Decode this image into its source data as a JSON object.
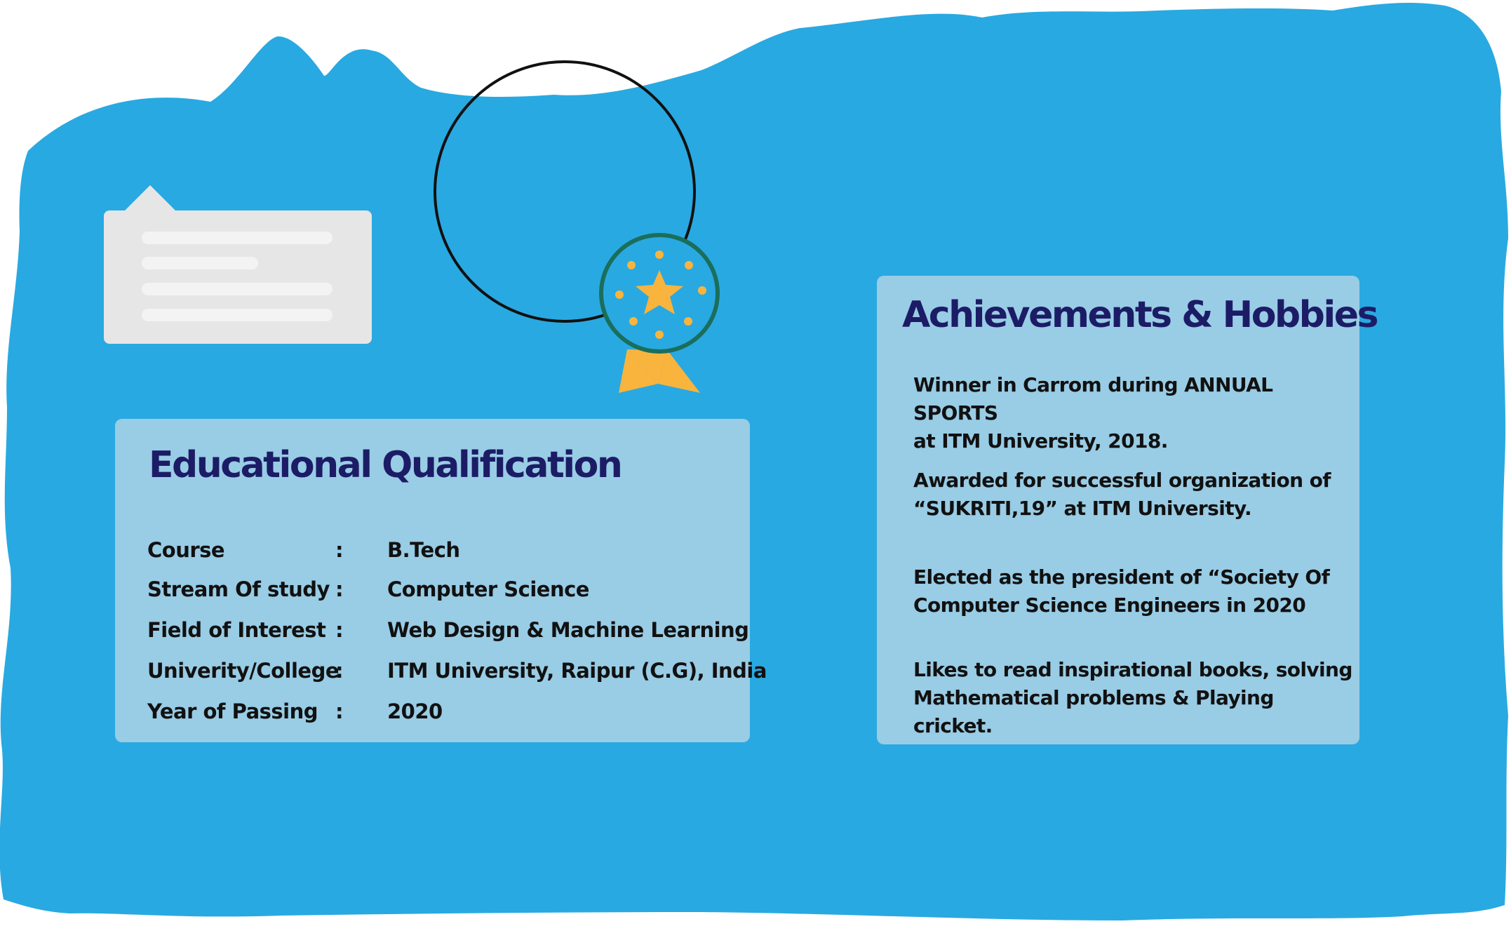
{
  "colors": {
    "background_blob": "#29a9e1",
    "panel": "#99cce5",
    "title_text": "#1c1c66",
    "body_text": "#111111",
    "chat_card": "#e6e6e6",
    "chat_bar": "#f3f3f3",
    "medal_ring": "#1a6e5b",
    "medal_fill": "#29a9e1",
    "medal_ribbon": "#f9b43d",
    "medal_star": "#f9b43d"
  },
  "icons": {
    "chat": "chat-bubble-icon",
    "medal": "award-medal-icon",
    "star": "star-icon"
  },
  "education": {
    "title": "Educational Qualification",
    "rows": [
      {
        "label": "Course",
        "sep": ":",
        "value": "B.Tech"
      },
      {
        "label": "Stream Of study",
        "sep": ":",
        "value": "Computer Science"
      },
      {
        "label": "Field of Interest",
        "sep": ":",
        "value": "Web Design & Machine Learning"
      },
      {
        "label": "Univerity/College",
        "sep": ":",
        "value": "ITM University, Raipur (C.G), India"
      },
      {
        "label": "Year of Passing",
        "sep": ":",
        "value": "2020"
      }
    ]
  },
  "achievements": {
    "title": "Achievements & Hobbies",
    "items": [
      {
        "line1": "Winner in Carrom during ANNUAL SPORTS",
        "line2": "at ITM University, 2018."
      },
      {
        "line1": "Awarded for successful organization of",
        "line2": "“SUKRITI,19” at ITM University."
      },
      {
        "line1": "Elected as the president of “Society Of",
        "line2": "Computer Science Engineers in 2020"
      },
      {
        "line1": "Likes to read inspirational books, solving",
        "line2": "Mathematical problems & Playing cricket."
      }
    ]
  }
}
